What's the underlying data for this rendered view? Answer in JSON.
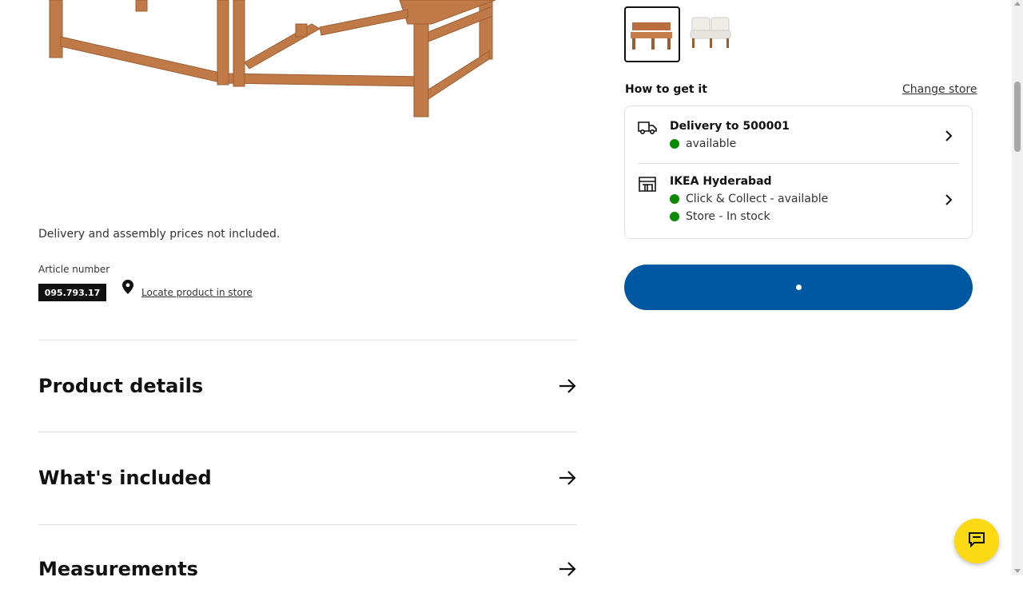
{
  "product": {
    "note": "Delivery and assembly prices not included.",
    "article_label": "Article number",
    "article_number": "095.793.17",
    "locate_link": "Locate product in store"
  },
  "sections": [
    {
      "title": "Product details"
    },
    {
      "title": "What's included"
    },
    {
      "title": "Measurements"
    }
  ],
  "purchase": {
    "how_title": "How to get it",
    "change_store": "Change store",
    "delivery": {
      "title": "Delivery to 500001",
      "status": "available"
    },
    "store": {
      "title": "IKEA Hyderabad",
      "click_collect": "Click & Collect - available",
      "stock": "Store - In stock"
    }
  },
  "colors": {
    "accent": "#0058a3",
    "available": "#0a8a00",
    "chat": "#fbd914"
  },
  "icons": [
    "truck-icon",
    "store-icon",
    "location-pin-icon",
    "arrow-right-icon",
    "chevron-right-icon",
    "chat-icon"
  ]
}
